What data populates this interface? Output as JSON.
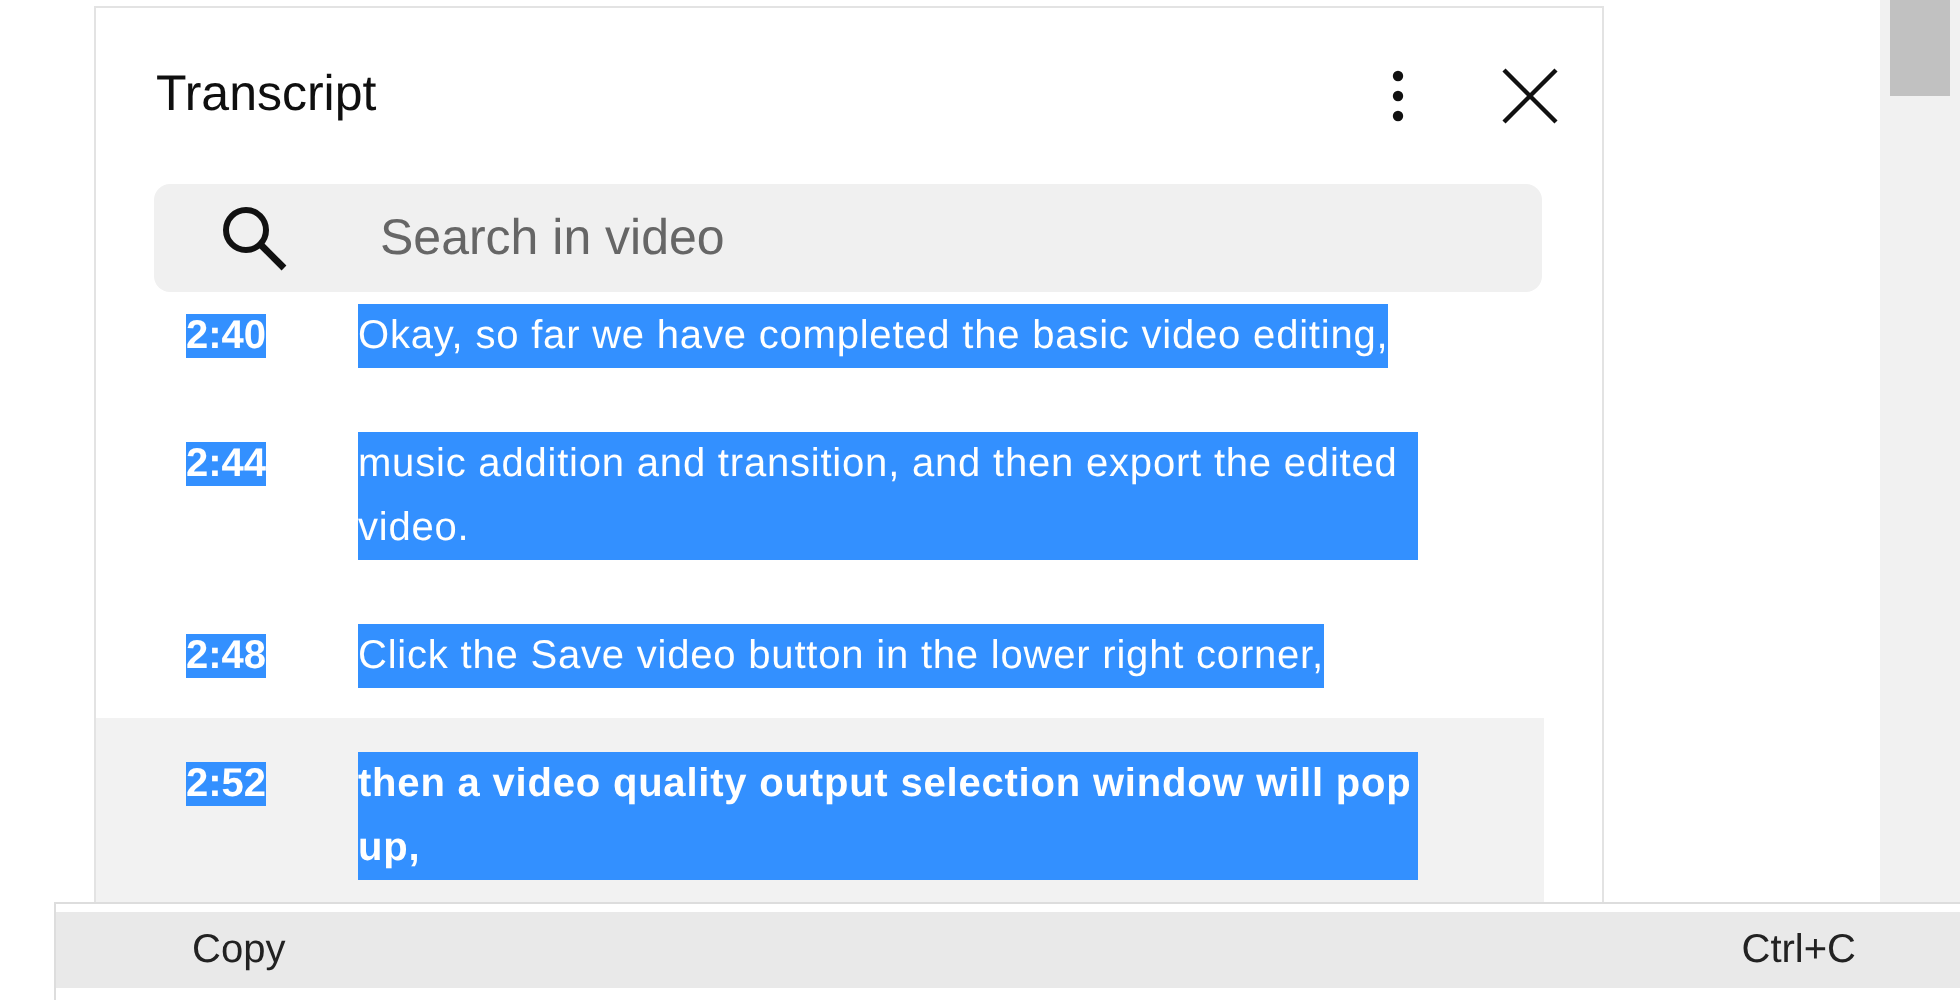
{
  "panel": {
    "title": "Transcript"
  },
  "search": {
    "placeholder": "Search in video"
  },
  "segments": [
    {
      "time": "2:40",
      "text": "Okay, so far we have completed the basic video editing,",
      "selected": true,
      "highlighted": false
    },
    {
      "time": "2:44",
      "text": "music addition and transition, and then export the edited video.",
      "selected": true,
      "highlighted": false
    },
    {
      "time": "2:48",
      "text": "Click the Save video button in the lower right corner,",
      "selected": true,
      "highlighted": false
    },
    {
      "time": "2:52",
      "text": "then a video quality output selection window will pop up,",
      "selected": true,
      "highlighted": true
    }
  ],
  "context_menu": [
    {
      "label": "Copy",
      "shortcut": "Ctrl+C"
    }
  ]
}
